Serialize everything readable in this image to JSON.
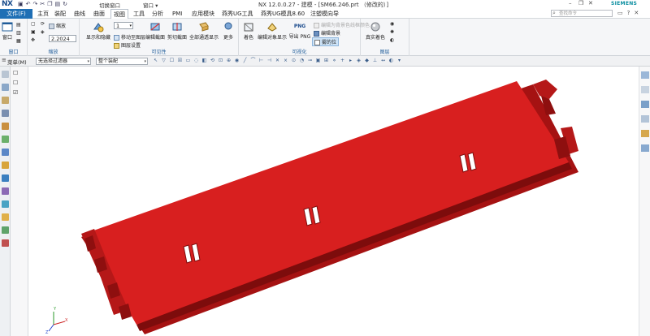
{
  "titlebar": {
    "logo": "NX",
    "switch_window": "切换窗口",
    "window_menu": "窗口 ▾",
    "title": "NX 12.0.0.27 - 建模 - [SM66.246.prt （修改的）]",
    "brand": "SIEMENS"
  },
  "menubar": {
    "file_tab": "文件(F)",
    "tabs": [
      "主页",
      "装配",
      "曲线",
      "曲面",
      "视图",
      "工具",
      "分析",
      "PMI",
      "应用模块",
      "燕秀UG工具",
      "燕秀UG模具8.60",
      "注塑模向导"
    ],
    "active_tab": "视图",
    "search_placeholder": "查找命令"
  },
  "ribbon": {
    "window_group": {
      "label": "窗口",
      "btn_window": "窗口"
    },
    "zoom_group": {
      "label": "缩放",
      "zoom_label": "缩放",
      "zoom_value": "2.2024"
    },
    "visibility_group": {
      "label": "可见性",
      "layer_value": "1",
      "show_hide": "显示和隐藏",
      "move_to_layer": "移动至图层",
      "layer_settings": "图层设置",
      "edit_section": "编辑截面",
      "clip_section": "剪切截面",
      "show_all_channels": "全部通透显示",
      "more": "更多"
    },
    "visualization_group": {
      "label": "可视化",
      "true_shading": "着色",
      "edit_object_display": "编辑对象显示",
      "export_png": "导出 PNG",
      "png_badge": "PNG",
      "edit_background": "编辑背景",
      "wireframe_color": "编辑为背景色线框颜色",
      "fog": "雾的位"
    },
    "layer_group": {
      "label": "图层",
      "true_color": "真实着色"
    }
  },
  "filterbar": {
    "menu": "菜单(M)",
    "filter": "无选择过滤器",
    "assembly": "整个装配"
  },
  "colors": {
    "accent": "#1f6fb5",
    "model_top": "#e02222",
    "model_side": "#b01414",
    "model_dark": "#8a0e0e"
  },
  "viewport": {
    "axis_labels": [
      "X",
      "Y",
      "Z"
    ]
  }
}
